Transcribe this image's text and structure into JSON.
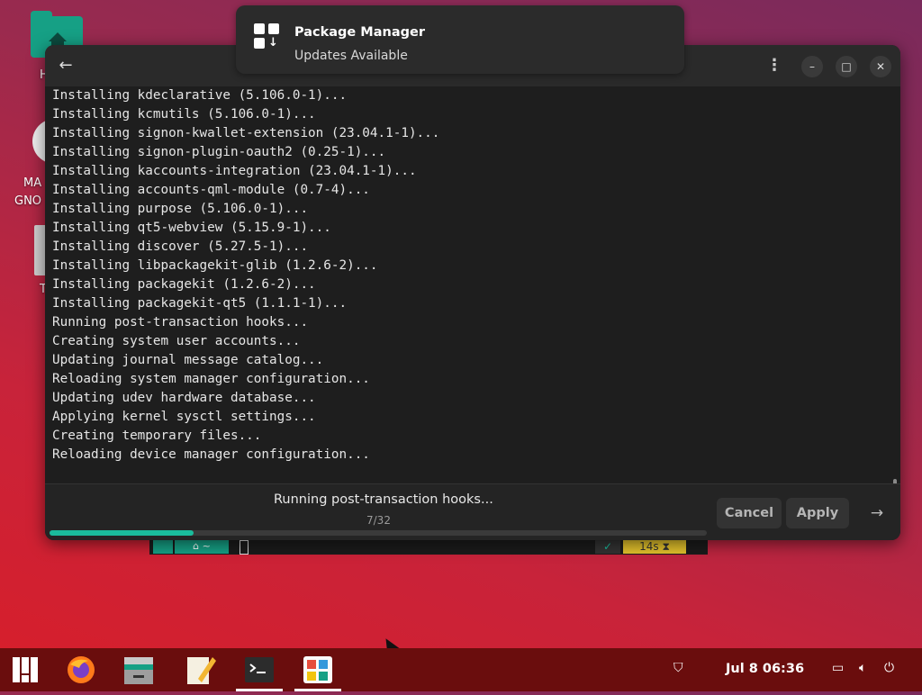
{
  "desktop": {
    "icons": [
      {
        "name": "home",
        "label": "H"
      },
      {
        "name": "manjaro-gnome",
        "label_line1": "MA",
        "label_line2": "GNO"
      },
      {
        "name": "trash",
        "label": "T"
      }
    ]
  },
  "notification": {
    "title": "Package Manager",
    "subtitle": "Updates Available",
    "icon": "package-manager-icon"
  },
  "window": {
    "back_icon": "←",
    "menu_icon": "⋮",
    "minimize_icon": "–",
    "maximize_icon": "□",
    "close_icon": "✕",
    "log_lines": [
      "Installing kdeclarative (5.106.0-1)...",
      "Installing kcmutils (5.106.0-1)...",
      "Installing signon-kwallet-extension (23.04.1-1)...",
      "Installing signon-plugin-oauth2 (0.25-1)...",
      "Installing kaccounts-integration (23.04.1-1)...",
      "Installing accounts-qml-module (0.7-4)...",
      "Installing purpose (5.106.0-1)...",
      "Installing qt5-webview (5.15.9-1)...",
      "Installing discover (5.27.5-1)...",
      "Installing libpackagekit-glib (1.2.6-2)...",
      "Installing packagekit (1.2.6-2)...",
      "Installing packagekit-qt5 (1.1.1-1)...",
      "Running post-transaction hooks...",
      "Creating system user accounts...",
      "Updating journal message catalog...",
      "Reloading system manager configuration...",
      "Updating udev hardware database...",
      "Applying kernel sysctl settings...",
      "Creating temporary files...",
      "Reloading device manager configuration..."
    ],
    "footer": {
      "status": "Running post-transaction hooks...",
      "progress_text": "7/32",
      "progress_fraction": 0.21875,
      "cancel_label": "Cancel",
      "apply_label": "Apply",
      "next_icon": "→"
    }
  },
  "terminal_prompt": {
    "dir": "~",
    "check": "✓",
    "elapsed": "14s"
  },
  "taskbar": {
    "apps": [
      "manjaro-menu",
      "firefox",
      "files",
      "text-editor",
      "terminal",
      "package-manager"
    ],
    "clock": "Jul 8  06:36"
  },
  "colors": {
    "accent": "#1abc9c",
    "taskbar": "#6a0d0d"
  }
}
